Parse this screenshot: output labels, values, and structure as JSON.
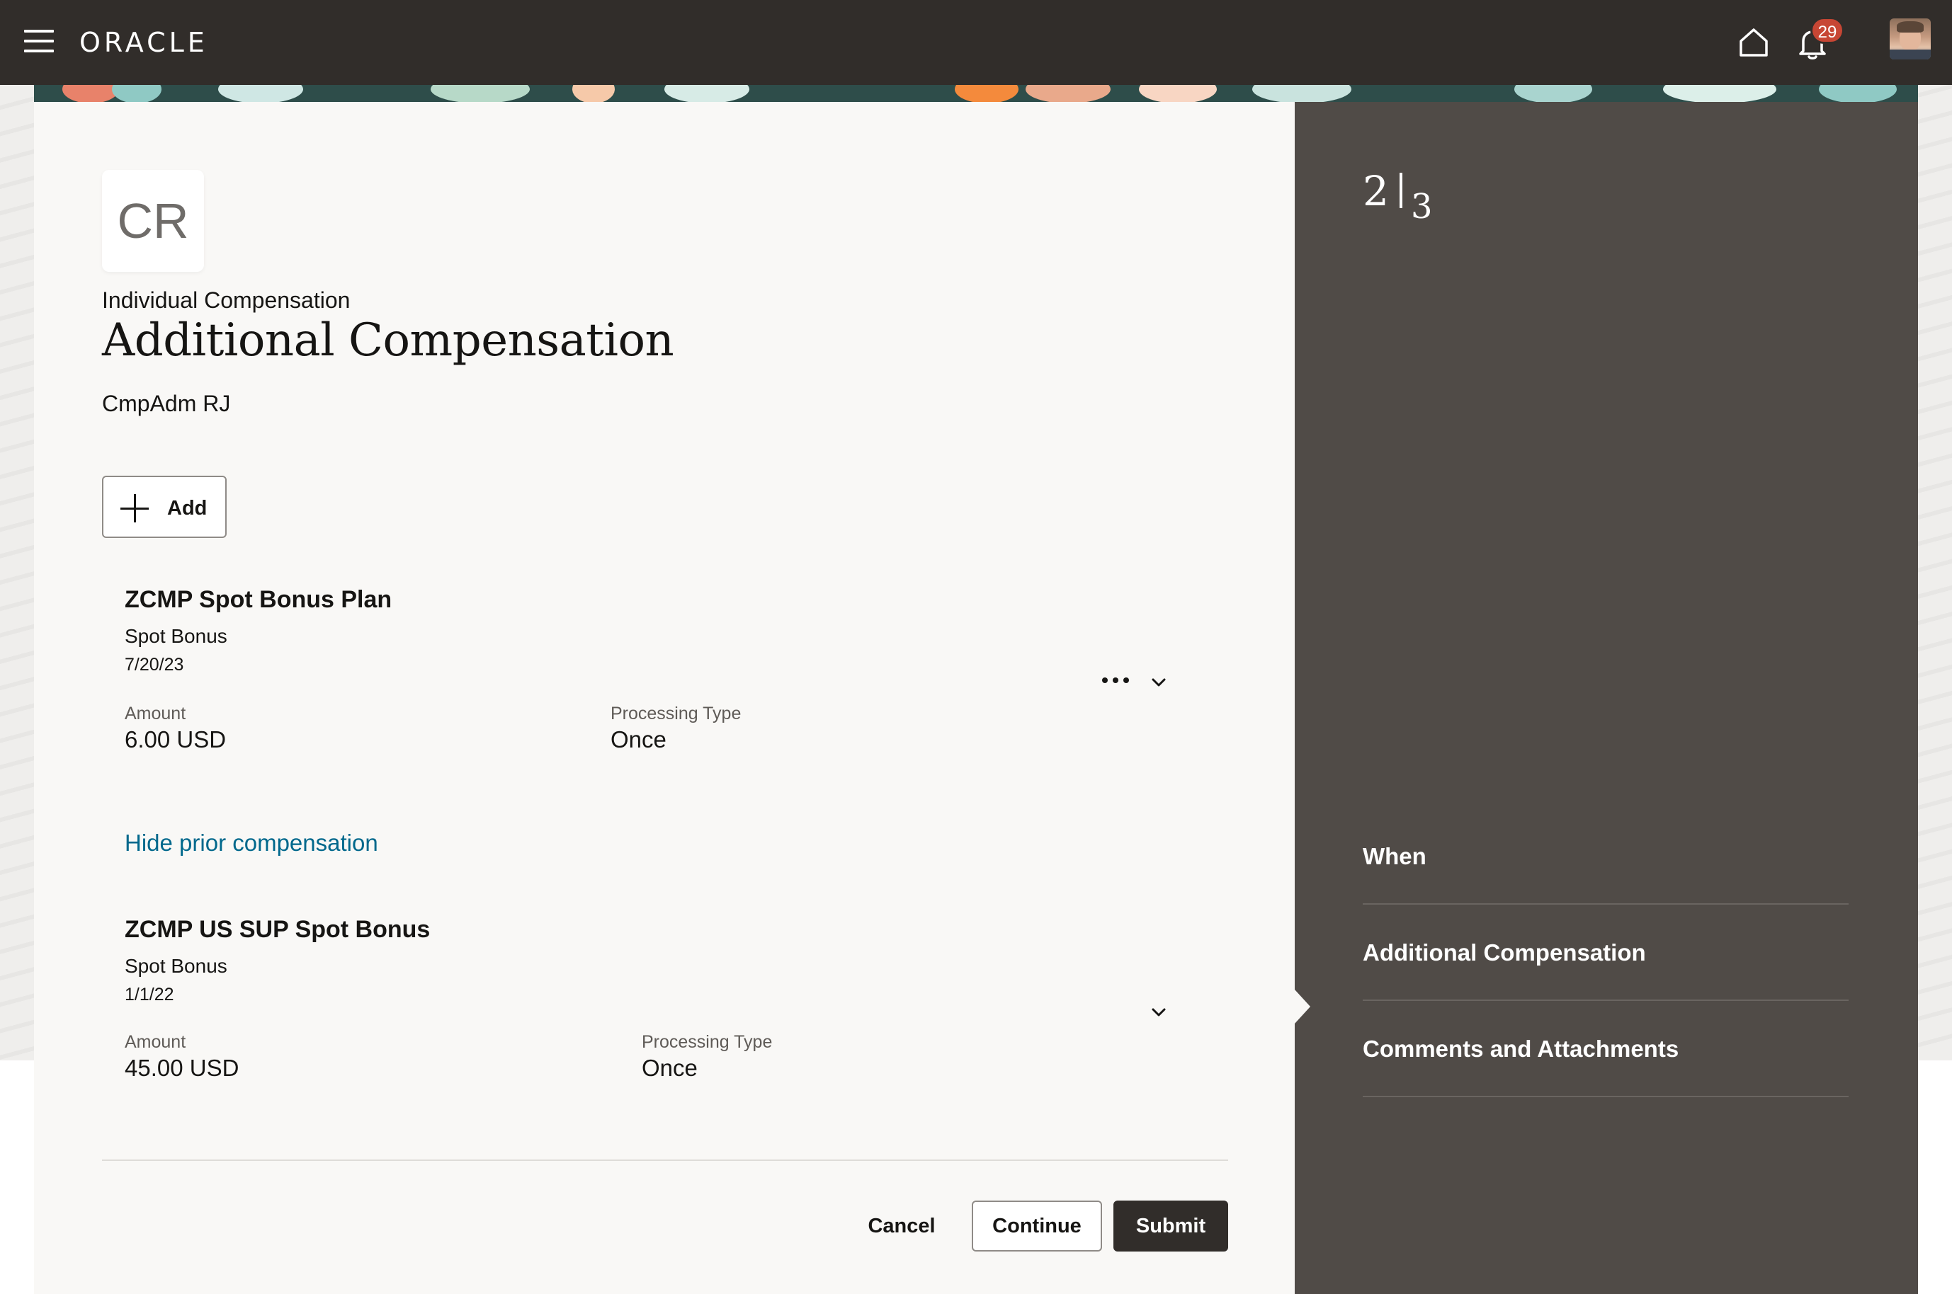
{
  "header": {
    "logo": "ORACLE",
    "notifications_count": "29"
  },
  "card": {
    "initials": "CR",
    "eyebrow": "Individual Compensation",
    "title": "Additional Compensation",
    "person": "CmpAdm RJ",
    "add_label": "Add"
  },
  "compensations": [
    {
      "name": "ZCMP Spot Bonus Plan",
      "type": "Spot Bonus",
      "date": "7/20/23",
      "amount_label": "Amount",
      "amount": "6.00 USD",
      "processing_label": "Processing Type",
      "processing": "Once"
    },
    {
      "name": "ZCMP US SUP Spot Bonus",
      "type": "Spot Bonus",
      "date": "1/1/22",
      "amount_label": "Amount",
      "amount": "45.00 USD",
      "processing_label": "Processing Type",
      "processing": "Once"
    }
  ],
  "hide_prior_link": "Hide prior compensation",
  "footer": {
    "cancel": "Cancel",
    "continue": "Continue",
    "submit": "Submit"
  },
  "train": {
    "current": "2",
    "total": "3",
    "steps": [
      "When",
      "Additional Compensation",
      "Comments and Attachments"
    ]
  },
  "colors": {
    "header_bg": "#312d2a",
    "train_bg": "#504b47",
    "link": "#00688c",
    "badge": "#c74634",
    "primary_button": "#312d2a"
  }
}
